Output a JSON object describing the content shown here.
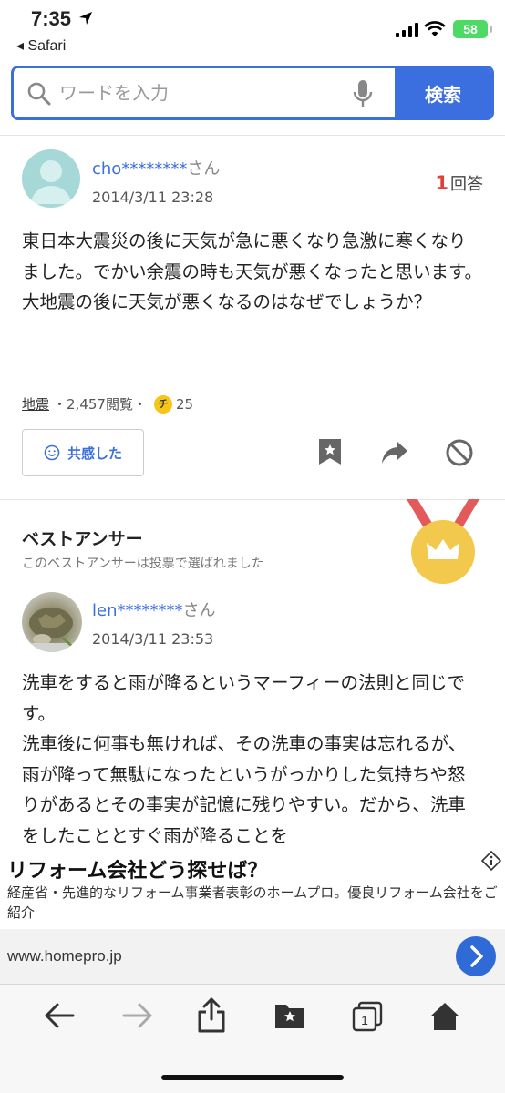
{
  "status_bar": {
    "time": "7:35",
    "back_app": "◂ Safari",
    "battery": "58"
  },
  "search": {
    "placeholder": "ワードを入力",
    "button_label": "検索"
  },
  "question": {
    "user": "cho********",
    "honorific": "さん",
    "date": "2014/3/11 23:28",
    "answer_count": "1",
    "answer_label": "回答",
    "body": "東日本大震災の後に天気が急に悪くなり急激に寒くなりました。でかい余震の時も天気が悪くなったと思います。大地震の後に天気が悪くなるのはなぜでしょうか？",
    "category": "地震",
    "views": "・2,457閲覧・",
    "coin_label": "チ",
    "coins": "25",
    "empathy_label": "共感した"
  },
  "best_answer": {
    "title": "ベストアンサー",
    "subtitle": "このベストアンサーは投票で選ばれました",
    "user": "len********",
    "honorific": "さん",
    "date": "2014/3/11 23:53",
    "body": "洗車をすると雨が降るというマーフィーの法則と同じです。\n洗車後に何事も無ければ、その洗車の事実は忘れるが、雨が降って無駄になったというがっかりした気持ちや怒りがあるとその事実が記憶に残りやすい。だから、洗車をしたこととすぐ雨が降ることを"
  },
  "ad": {
    "title": "リフォーム会社どう探せば？",
    "description": "経産省・先進的なリフォーム事業者表彰のホームプロ。優良リフォーム会社をご紹介",
    "url": "www.homepro.jp"
  },
  "colors": {
    "accent": "#3b6fe0",
    "answer_count": "#e0403a",
    "medal": "#f2c94c",
    "ribbon": "#e25a5a"
  }
}
